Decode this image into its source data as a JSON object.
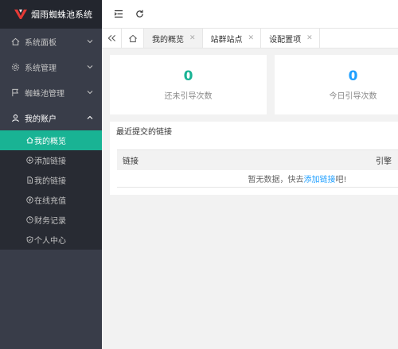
{
  "app": {
    "title": "烟雨蜘蛛池系统"
  },
  "sidebar": {
    "items": [
      {
        "label": "系统面板",
        "icon": "home-icon",
        "arrow": "down"
      },
      {
        "label": "系统管理",
        "icon": "gear-icon",
        "arrow": "down"
      },
      {
        "label": "蜘蛛池管理",
        "icon": "flag-icon",
        "arrow": "down"
      },
      {
        "label": "我的账户",
        "icon": "user-icon",
        "arrow": "up"
      }
    ],
    "submenu": [
      {
        "label": "我的概览",
        "icon": "home-icon",
        "active": true
      },
      {
        "label": "添加链接",
        "icon": "add-circle-icon"
      },
      {
        "label": "我的链接",
        "icon": "document-icon"
      },
      {
        "label": "在线充值",
        "icon": "yen-icon"
      },
      {
        "label": "财务记录",
        "icon": "clock-icon"
      },
      {
        "label": "个人中心",
        "icon": "shield-icon"
      }
    ]
  },
  "tabs": [
    {
      "label": "我的概览",
      "active": true
    },
    {
      "label": "站群站点"
    },
    {
      "label": "设配置项"
    }
  ],
  "stats": [
    {
      "value": "0",
      "label": "还未引导次数",
      "color": "#19b394"
    },
    {
      "value": "0",
      "label": "今日引导次数",
      "color": "#1e9fff"
    }
  ],
  "recent": {
    "title": "最近提交的链接",
    "columns": [
      "链接",
      "引擎"
    ],
    "empty_prefix": "暂无数据，快去",
    "empty_link": "添加链接",
    "empty_suffix": "吧!"
  },
  "colors": {
    "accent": "#19b394",
    "link": "#1e9fff",
    "sidebar": "#393d49"
  }
}
